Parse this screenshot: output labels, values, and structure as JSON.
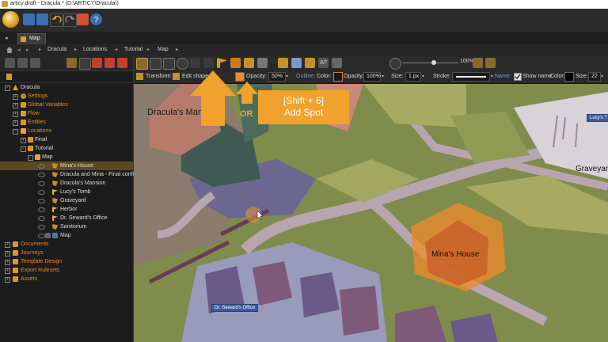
{
  "window": {
    "title": "articy:draft - Dracula * (D:\\ARTICY\\Dracula\\)"
  },
  "tabs": [
    {
      "label": "Map"
    }
  ],
  "breadcrumb": [
    "Dracula",
    "Locations",
    "Tutorial",
    "Map"
  ],
  "tree": {
    "root": "Dracula",
    "items": [
      {
        "label": "Settings",
        "kind": "cat"
      },
      {
        "label": "Global Variables",
        "kind": "cat"
      },
      {
        "label": "Flow",
        "kind": "cat"
      },
      {
        "label": "Entities",
        "kind": "cat"
      },
      {
        "label": "Locations",
        "kind": "cat"
      },
      {
        "label": "Final",
        "kind": "item"
      },
      {
        "label": "Tutorial",
        "kind": "item"
      },
      {
        "label": "Map",
        "kind": "item"
      },
      {
        "label": "Mina's House",
        "kind": "child",
        "selected": true
      },
      {
        "label": "Dracula and Mina - Final confron",
        "kind": "child"
      },
      {
        "label": "Dracula's Mansion",
        "kind": "child"
      },
      {
        "label": "Lucy's Tomb",
        "kind": "child"
      },
      {
        "label": "Graveyard",
        "kind": "child"
      },
      {
        "label": "Herbor",
        "kind": "child"
      },
      {
        "label": "Dr. Seward's Office",
        "kind": "child"
      },
      {
        "label": "Sanitorium",
        "kind": "child"
      },
      {
        "label": "Map",
        "kind": "child"
      },
      {
        "label": "Documents",
        "kind": "cat"
      },
      {
        "label": "Journeys",
        "kind": "cat"
      },
      {
        "label": "Template Design",
        "kind": "cat"
      },
      {
        "label": "Export Rulesets",
        "kind": "cat"
      },
      {
        "label": "Assets",
        "kind": "cat"
      }
    ]
  },
  "toolbar": {
    "zoom": "100%"
  },
  "props": {
    "transform": "Transform",
    "edit_shape": "Edit shape",
    "opacity_label": "Opacity:",
    "opacity_value": "50%",
    "outline_label": "Outline:",
    "color_label": "Color:",
    "opacity2_label": "Opacity:",
    "opacity2_value": "100%",
    "size_label": "Size:",
    "size_value": "1 px",
    "stroke_label": "Stroke:",
    "name_label": "Name:",
    "show_name": "Show name",
    "color2_label": "Color:",
    "size2_label": "Size:",
    "size2_value": "22"
  },
  "map_labels": {
    "mansion": "Dracula's Mansion",
    "minas_house": "Mina's House",
    "graveyard": "Graveyard",
    "lucys_tomb": "Lucy's T",
    "seward": "Dr. Seward's Office"
  },
  "hint": {
    "line1": "[Shift + 6]",
    "line2": "Add Spot",
    "or": "OR"
  },
  "colors": {
    "accent": "#f0a22c",
    "selection": "#5a4a1e",
    "category": "#e28a2a"
  }
}
